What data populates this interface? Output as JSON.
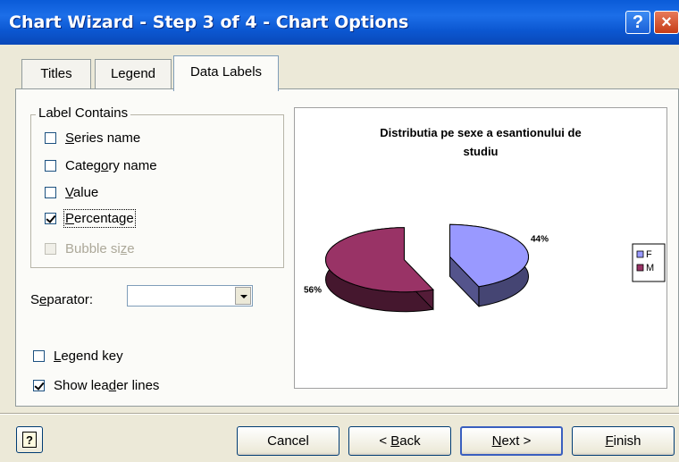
{
  "window": {
    "title": "Chart Wizard - Step 3 of 4 - Chart Options",
    "help_btn": "?",
    "close_btn": "×"
  },
  "tabs": [
    {
      "label": "Titles",
      "active": false
    },
    {
      "label": "Legend",
      "active": false
    },
    {
      "label": "Data Labels",
      "active": true
    }
  ],
  "label_contains": {
    "legend": "Label Contains",
    "options": [
      {
        "pre": "",
        "ul": "S",
        "post": "eries name",
        "checked": false,
        "disabled": false
      },
      {
        "pre": "Categ",
        "ul": "o",
        "post": "ry name",
        "checked": false,
        "disabled": false
      },
      {
        "pre": "",
        "ul": "V",
        "post": "alue",
        "checked": false,
        "disabled": false
      },
      {
        "pre": "",
        "ul": "P",
        "post": "ercentage",
        "checked": true,
        "disabled": false
      },
      {
        "pre": "Bubble si",
        "ul": "z",
        "post": "e",
        "checked": false,
        "disabled": true
      }
    ]
  },
  "separator": {
    "pre": "S",
    "ul": "e",
    "post": "parator:",
    "value": ""
  },
  "legend_key": {
    "pre": "",
    "ul": "L",
    "post": "egend key",
    "checked": false
  },
  "leader_lines": {
    "pre": "Show lea",
    "ul": "d",
    "post": "er lines",
    "checked": true
  },
  "chart_data": {
    "type": "pie",
    "title": "Distributia pe sexe a esantionului de studiu",
    "categories": [
      "F",
      "M"
    ],
    "values": [
      44,
      56
    ],
    "data_labels": [
      "44%",
      "56%"
    ],
    "colors": [
      "#9999ff",
      "#993366"
    ],
    "legend_position": "right",
    "exploded": true,
    "style": "3d"
  },
  "buttons": {
    "help_icon": "?",
    "cancel": "Cancel",
    "back": {
      "pre": "< ",
      "ul": "B",
      "post": "ack"
    },
    "next": {
      "pre": "",
      "ul": "N",
      "post": "ext >"
    },
    "finish": {
      "pre": "",
      "ul": "F",
      "post": "inish"
    }
  }
}
